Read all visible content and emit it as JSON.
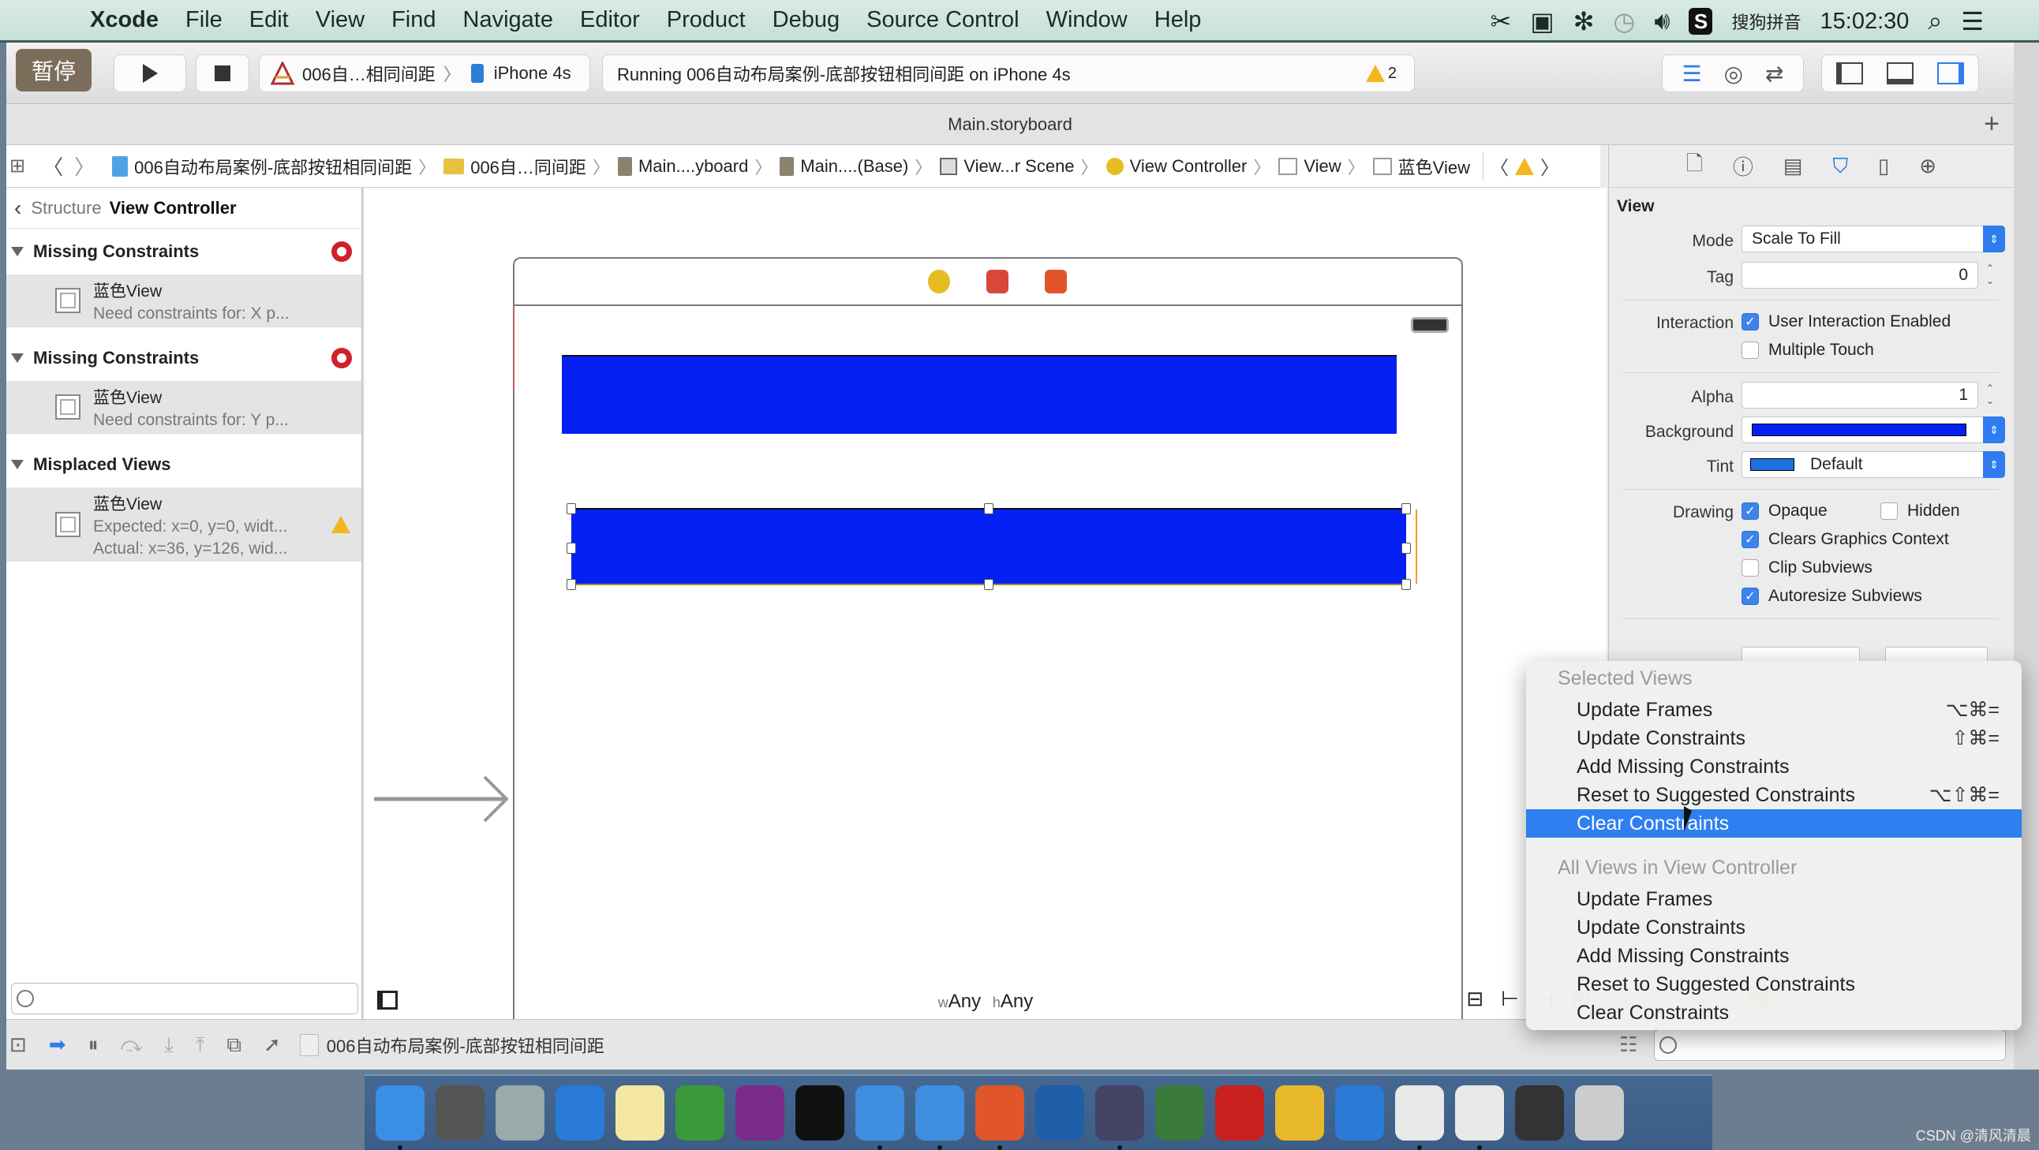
{
  "menubar": {
    "app": "Xcode",
    "items": [
      "File",
      "Edit",
      "View",
      "Find",
      "Navigate",
      "Editor",
      "Product",
      "Debug",
      "Source Control",
      "Window",
      "Help"
    ],
    "input_method": "搜狗拼音",
    "clock": "15:02:30"
  },
  "toolbar": {
    "pause_label": "暂停",
    "scheme": "006自…相同间距",
    "destination": "iPhone 4s",
    "status": "Running 006自动布局案例-底部按钮相同间距 on iPhone 4s",
    "warning_count": "2"
  },
  "tab": {
    "title": "Main.storyboard"
  },
  "jumpbar": {
    "items": [
      {
        "icon": "project-icon",
        "label": "006自动布局案例-底部按钮相同间距"
      },
      {
        "icon": "folder-icon",
        "label": "006自…同间距"
      },
      {
        "icon": "storyboard-file-icon",
        "label": "Main....yboard"
      },
      {
        "icon": "storyboard-file-icon",
        "label": "Main....(Base)"
      },
      {
        "icon": "scene-icon",
        "label": "View...r Scene"
      },
      {
        "icon": "view-controller-icon",
        "label": "View Controller"
      },
      {
        "icon": "view-icon",
        "label": "View"
      },
      {
        "icon": "view-icon",
        "label": "蓝色View"
      }
    ]
  },
  "issues": {
    "crumb_a": "Structure",
    "crumb_b": "View Controller",
    "groups": [
      {
        "title": "Missing Constraints",
        "severity": "error",
        "item": {
          "name": "蓝色View",
          "lines": [
            "Need constraints for: X p..."
          ]
        }
      },
      {
        "title": "Missing Constraints",
        "severity": "error",
        "item": {
          "name": "蓝色View",
          "lines": [
            "Need constraints for: Y p..."
          ]
        }
      },
      {
        "title": "Misplaced Views",
        "severity": "warning",
        "item": {
          "name": "蓝色View",
          "lines": [
            "Expected: x=0, y=0, widt...",
            "Actual: x=36, y=126, wid..."
          ]
        }
      }
    ]
  },
  "canvas": {
    "size_w_prefix": "w",
    "size_w": "Any",
    "size_h_prefix": "h",
    "size_h": "Any",
    "view_color": "#0520f5"
  },
  "inspector": {
    "section": "View",
    "mode_label": "Mode",
    "mode_value": "Scale To Fill",
    "tag_label": "Tag",
    "tag_value": "0",
    "interaction_label": "Interaction",
    "user_interaction": {
      "label": "User Interaction Enabled",
      "checked": true
    },
    "multiple_touch": {
      "label": "Multiple Touch",
      "checked": false
    },
    "alpha_label": "Alpha",
    "alpha_value": "1",
    "background_label": "Background",
    "background_color": "#0520f5",
    "tint_label": "Tint",
    "tint_value": "Default",
    "tint_color": "#1e6fe0",
    "drawing_label": "Drawing",
    "opaque": {
      "label": "Opaque",
      "checked": true
    },
    "hidden": {
      "label": "Hidden",
      "checked": false
    },
    "clears_graphics": {
      "label": "Clears Graphics Context",
      "checked": true
    },
    "clip_subviews": {
      "label": "Clip Subviews",
      "checked": false
    },
    "autoresize_subviews": {
      "label": "Autoresize Subviews",
      "checked": true
    }
  },
  "context_menu": {
    "header_selected": "Selected Views",
    "selected_items": [
      {
        "label": "Update Frames",
        "shortcut": "⌥⌘="
      },
      {
        "label": "Update Constraints",
        "shortcut": "⇧⌘="
      },
      {
        "label": "Add Missing Constraints",
        "shortcut": ""
      },
      {
        "label": "Reset to Suggested Constraints",
        "shortcut": "⌥⇧⌘="
      },
      {
        "label": "Clear Constraints",
        "shortcut": "",
        "highlighted": true
      }
    ],
    "header_all": "All Views in View Controller",
    "all_items": [
      {
        "label": "Update Frames"
      },
      {
        "label": "Update Constraints"
      },
      {
        "label": "Add Missing Constraints"
      },
      {
        "label": "Reset to Suggested Constraints"
      },
      {
        "label": "Clear Constraints"
      }
    ]
  },
  "debugbar": {
    "target": "006自动布局案例-底部按钮相同间距"
  },
  "dock": {
    "apps": [
      "Finder",
      "System Preferences",
      "Launchpad",
      "Safari",
      "Notes",
      "Excel",
      "OneNote",
      "Terminal",
      "Xcode",
      "Simulator",
      "PowerPoint",
      "Screenshot",
      "Video",
      "Tool",
      "FileZilla",
      "App",
      "Word",
      "Instruments",
      "Instruments",
      "Screen",
      "Trash"
    ]
  },
  "watermark": "CSDN @清风清晨"
}
